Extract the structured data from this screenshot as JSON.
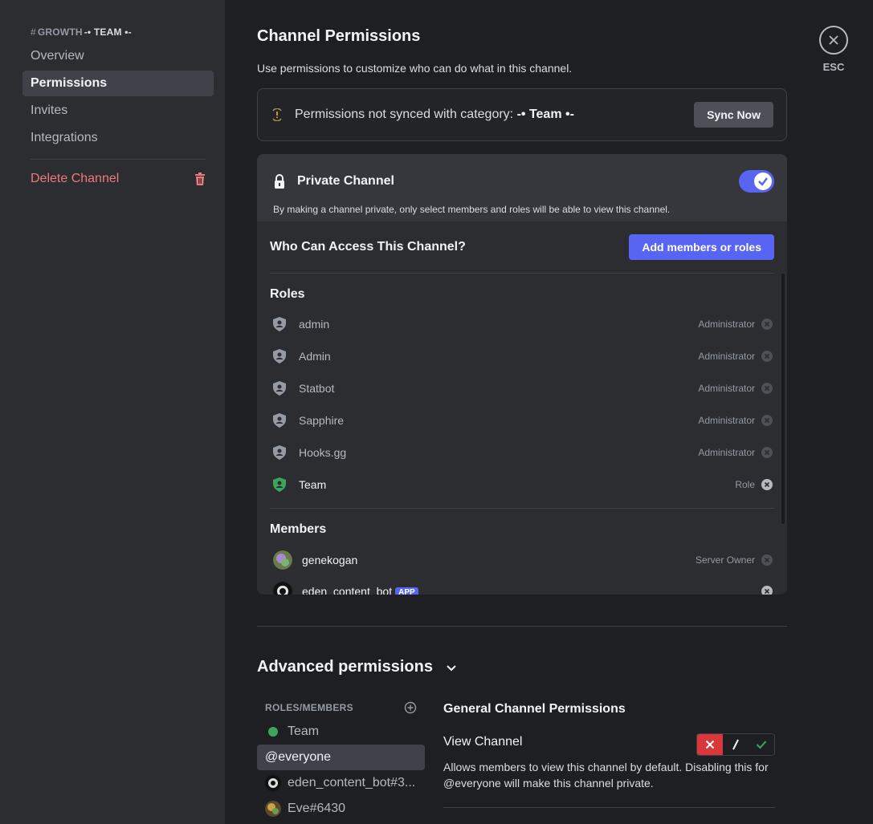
{
  "sidebar": {
    "header_hash": "#",
    "header_channel": "GROWTH",
    "header_category": "-• TEAM •-",
    "items": [
      {
        "label": "Overview"
      },
      {
        "label": "Permissions"
      },
      {
        "label": "Invites"
      },
      {
        "label": "Integrations"
      }
    ],
    "delete_label": "Delete Channel"
  },
  "main": {
    "title": "Channel Permissions",
    "description": "Use permissions to customize who can do what in this channel.",
    "sync": {
      "text": "Permissions not synced with category: ",
      "category": "-• Team •-",
      "button": "Sync Now"
    },
    "private": {
      "title": "Private Channel",
      "description": "By making a channel private, only select members and roles will be able to view this channel.",
      "enabled": true
    },
    "access": {
      "title": "Who Can Access This Channel?",
      "add_button": "Add members or roles",
      "roles_label": "Roles",
      "roles": [
        {
          "name": "admin",
          "type": "Administrator",
          "color": "#b5bac1"
        },
        {
          "name": "Admin",
          "type": "Administrator",
          "color": "#b5bac1"
        },
        {
          "name": "Statbot",
          "type": "Administrator",
          "color": "#b5bac1"
        },
        {
          "name": "Sapphire",
          "type": "Administrator",
          "color": "#b5bac1"
        },
        {
          "name": "Hooks.gg",
          "type": "Administrator",
          "color": "#b5bac1"
        },
        {
          "name": "Team",
          "type": "Role",
          "color": "#3ba55c"
        }
      ],
      "members_label": "Members",
      "members": [
        {
          "name": "genekogan",
          "type": "Server Owner"
        },
        {
          "name": "eden_content_bot",
          "badge": "APP",
          "type": ""
        }
      ]
    },
    "advanced": {
      "title": "Advanced permissions",
      "roles_members_label": "ROLES/MEMBERS",
      "list": [
        {
          "name": "Team"
        },
        {
          "name": "@everyone"
        },
        {
          "name": "eden_content_bot#3..."
        },
        {
          "name": "Eve#6430"
        }
      ],
      "section_title": "General Channel Permissions",
      "permission_title": "View Channel",
      "permission_desc": "Allows members to view this channel by default. Disabling this for @everyone will make this channel private.",
      "permission_state": "deny"
    }
  },
  "close": {
    "label": "ESC"
  },
  "colors": {
    "accent": "#5865f2",
    "danger": "#da373c",
    "success": "#3ba55c",
    "delete": "#f0787c"
  }
}
